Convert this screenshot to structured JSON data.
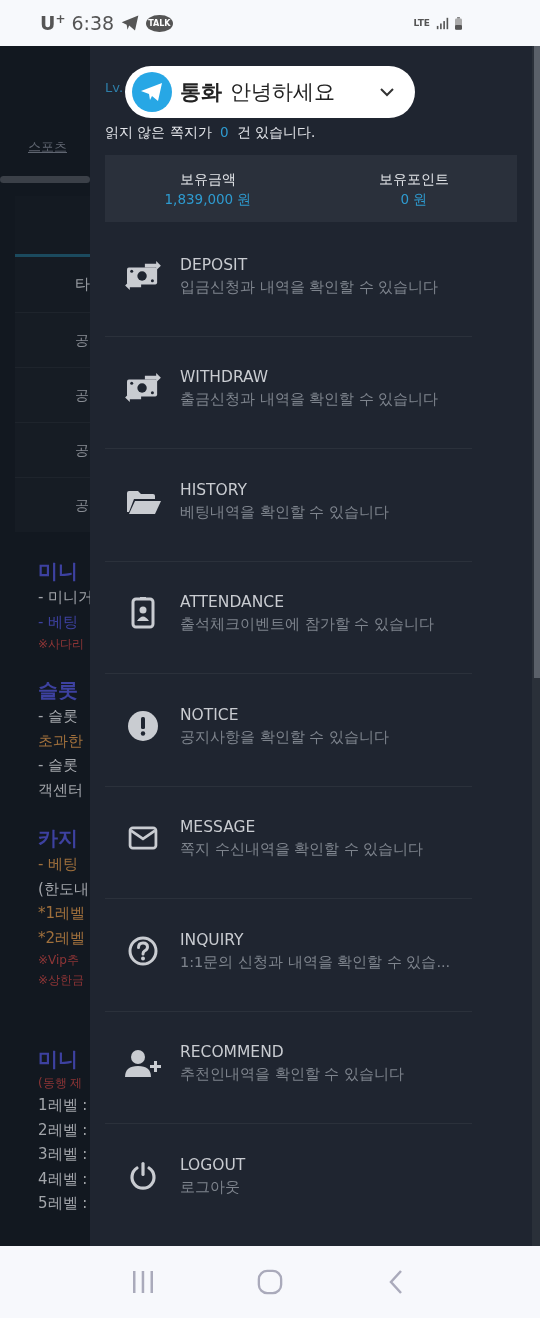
{
  "status_bar": {
    "carrier": "U$^{+}$",
    "time": "6:38",
    "chat_badge": "TALK",
    "network": "LTE"
  },
  "background_page": {
    "tab": "스포츠",
    "table_header": "타",
    "table_rows": [
      "공",
      "공",
      "공",
      "공"
    ],
    "notes": [
      {
        "kind": "heading",
        "text": "미니",
        "color": "#3d41a0"
      },
      {
        "kind": "line",
        "text": "- 미니거",
        "color": "#a3a6ab"
      },
      {
        "kind": "line",
        "text": "- 베팅",
        "color": "#3d41a0"
      },
      {
        "kind": "small",
        "text": "※사다리",
        "color": "#8e3536"
      },
      {
        "kind": "heading",
        "text": "슬롯",
        "color": "#3d41a0"
      },
      {
        "kind": "line",
        "text": "- 슬롯",
        "color": "#a3a6ab"
      },
      {
        "kind": "line",
        "text": "초과한",
        "color": "#a0703c"
      },
      {
        "kind": "line",
        "text": "- 슬롯",
        "color": "#a3a6ab"
      },
      {
        "kind": "line",
        "text": "객센터",
        "color": "#a3a6ab"
      },
      {
        "kind": "heading",
        "text": "카지",
        "color": "#3d41a0"
      },
      {
        "kind": "line",
        "text": "- 베팅",
        "color": "#a0703c"
      },
      {
        "kind": "line",
        "text": "(한도내",
        "color": "#a3a6ab"
      },
      {
        "kind": "line",
        "text": "*1레벨",
        "color": "#a0703c"
      },
      {
        "kind": "line",
        "text": "*2레벨",
        "color": "#a0703c"
      },
      {
        "kind": "small",
        "text": "※Vip추",
        "color": "#8e3536"
      },
      {
        "kind": "small",
        "text": "※상한금",
        "color": "#8e3536"
      },
      {
        "kind": "section",
        "text": "미니",
        "color": "#3d41a0"
      },
      {
        "kind": "small",
        "text": "(동행 제",
        "color": "#8e3536"
      },
      {
        "kind": "line",
        "text": "1레벨 :",
        "color": "#a3a6ab"
      },
      {
        "kind": "line",
        "text": "2레벨 :",
        "color": "#a3a6ab"
      },
      {
        "kind": "line",
        "text": "3레벨 :",
        "color": "#a3a6ab"
      },
      {
        "kind": "line",
        "text": "4레벨 :",
        "color": "#a3a6ab"
      },
      {
        "kind": "line",
        "text": "5레벨 :",
        "color": "#a3a6ab"
      }
    ]
  },
  "notification": {
    "app_label": "통화",
    "message": "안녕하세요"
  },
  "drawer": {
    "level_label": "Lv.",
    "unread": {
      "before": "읽지 않은 쪽지가",
      "count": "0",
      "after": "건 있습니다."
    },
    "balances": [
      {
        "label": "보유금액",
        "value": "1,839,000 원"
      },
      {
        "label": "보유포인트",
        "value": "0 원"
      }
    ],
    "menu": [
      {
        "kind": "money",
        "title": "DEPOSIT",
        "description": "입금신청과 내역을 확인할 수 있습니다"
      },
      {
        "kind": "money",
        "title": "WITHDRAW",
        "description": "출금신청과 내역을 확인할 수 있습니다"
      },
      {
        "kind": "folder",
        "title": "HISTORY",
        "description": "베팅내역을 확인할 수 있습니다"
      },
      {
        "kind": "badge",
        "title": "ATTENDANCE",
        "description": "출석체크이벤트에 참가할 수 있습니다"
      },
      {
        "kind": "alert",
        "title": "NOTICE",
        "description": "공지사항을 확인할 수 있습니다"
      },
      {
        "kind": "mail",
        "title": "MESSAGE",
        "description": "쪽지 수신내역을 확인할 수 있습니다"
      },
      {
        "kind": "question",
        "title": "INQUIRY",
        "description": "1:1문의 신청과 내역을 확인할 수 있습..."
      },
      {
        "kind": "user_add",
        "title": "RECOMMEND",
        "description": "추천인내역을 확인할 수 있습니다"
      },
      {
        "kind": "power",
        "title": "LOGOUT",
        "description": "로그아웃"
      }
    ]
  }
}
